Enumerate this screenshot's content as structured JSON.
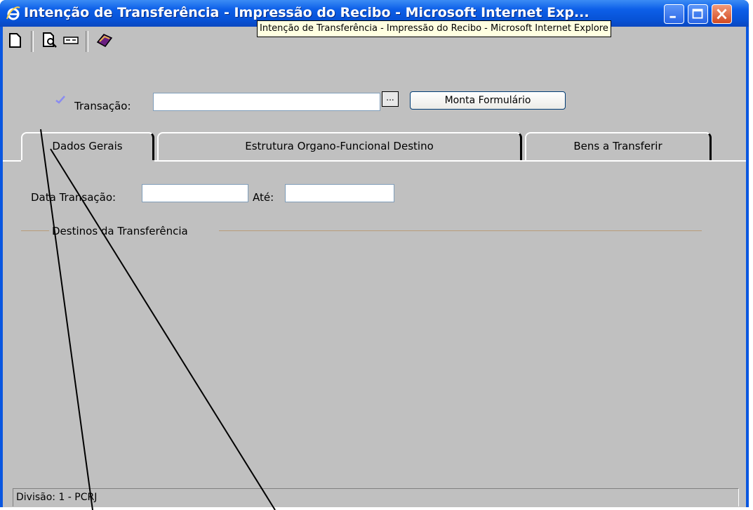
{
  "window": {
    "title": "Intenção de Transferência - Impressão do Recibo - Microsoft Internet Exp...",
    "tooltip": "Intenção de Transferência - Impressão do Recibo - Microsoft Internet Explore"
  },
  "toolbar": {
    "icons": [
      "new-page-icon",
      "print-preview-icon",
      "scanner-icon",
      "book-icon"
    ]
  },
  "form": {
    "transacao_label": "Transação:",
    "transacao_value": "",
    "browse_label": "...",
    "monta_button": "Monta Formulário"
  },
  "tabs": [
    {
      "label": "Dados Gerais",
      "active": true
    },
    {
      "label": "Estrutura Organo-Funcional Destino",
      "active": false
    },
    {
      "label": "Bens a Transferir",
      "active": false
    }
  ],
  "dados_gerais": {
    "data_label": "Data Transação:",
    "data_value": "",
    "ate_label": "Até:",
    "ate_value": "",
    "destinos_legend": "Destinos da Transferência"
  },
  "status": {
    "text": "Divisão: 1 - PCRJ"
  },
  "colors": {
    "titlebar": "#0a57e0",
    "client_bg": "#c0c0c0",
    "close_button": "#d24a22",
    "tooltip_bg": "#ffffe1",
    "checkmark": "#8a8cf0"
  }
}
